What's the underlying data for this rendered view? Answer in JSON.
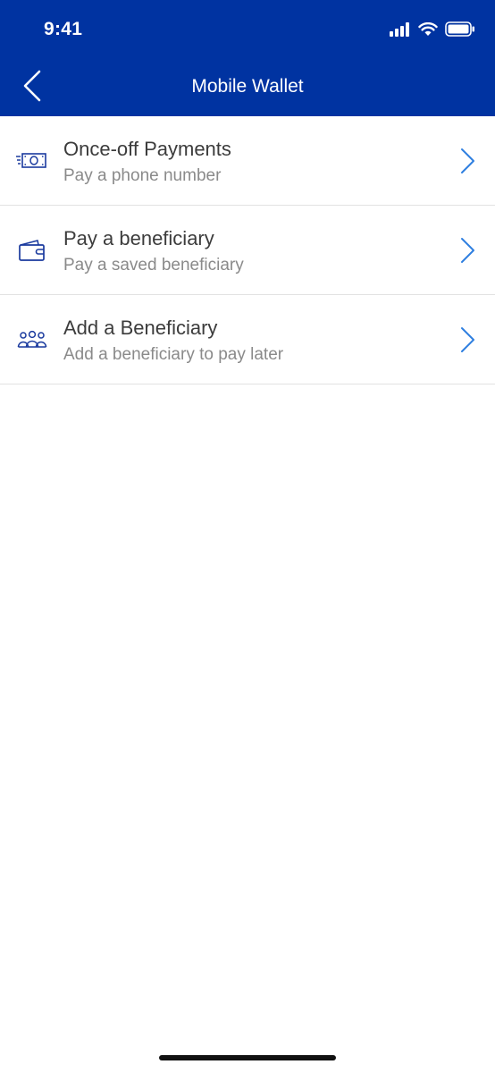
{
  "status_bar": {
    "time": "9:41",
    "icons": [
      "signal-icon",
      "wifi-icon",
      "battery-icon"
    ]
  },
  "nav": {
    "title": "Mobile Wallet",
    "back_icon": "chevron-left-icon"
  },
  "colors": {
    "header_bg": "#0033a1",
    "icon_blue": "#1a3a9e",
    "chevron_blue": "#2f7fe0",
    "title_text": "#3c3c3c",
    "subtitle_text": "#8a8a8a"
  },
  "menu": {
    "items": [
      {
        "title": "Once-off Payments",
        "subtitle": "Pay a phone number",
        "icon": "cash-payment-icon"
      },
      {
        "title": "Pay a beneficiary",
        "subtitle": "Pay a saved beneficiary",
        "icon": "wallet-icon"
      },
      {
        "title": "Add a Beneficiary",
        "subtitle": "Add a beneficiary to pay later",
        "icon": "people-group-icon"
      }
    ]
  }
}
